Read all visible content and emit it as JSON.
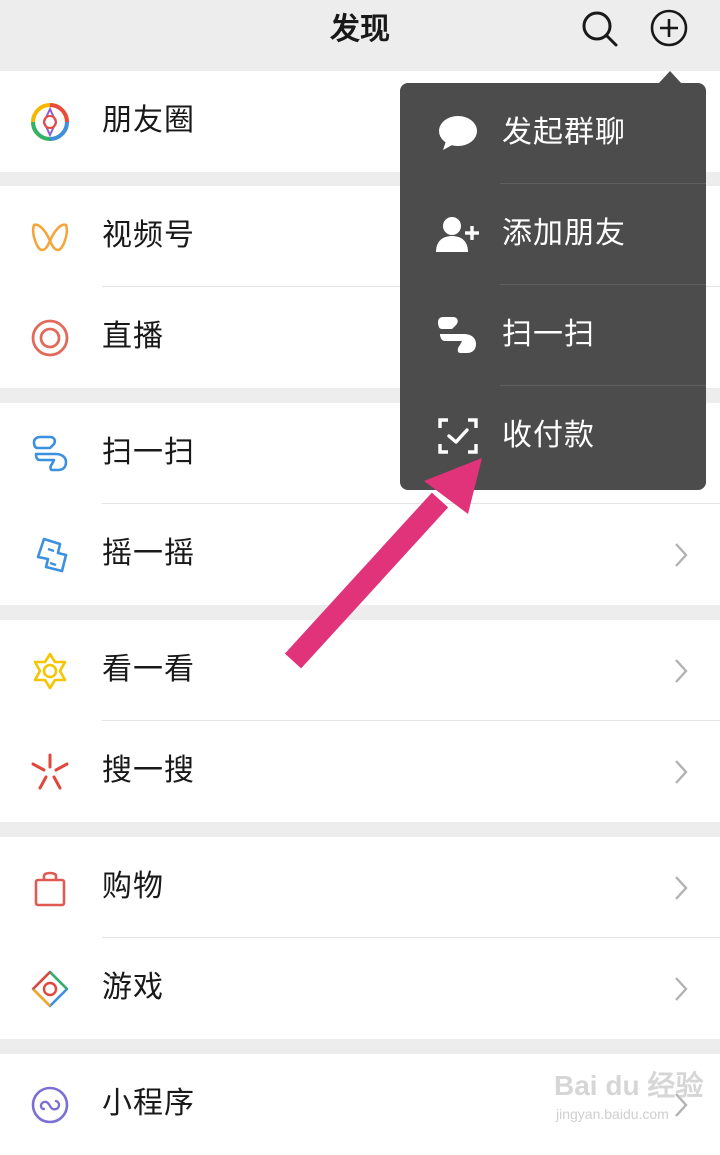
{
  "header": {
    "title": "发现",
    "icons": [
      "search-icon",
      "plus-circle-icon"
    ]
  },
  "groups": [
    {
      "items": [
        {
          "label": "朋友圈",
          "icon": "moments-icon"
        }
      ]
    },
    {
      "items": [
        {
          "label": "视频号",
          "icon": "channels-icon"
        },
        {
          "label": "直播",
          "icon": "live-icon"
        }
      ]
    },
    {
      "items": [
        {
          "label": "扫一扫",
          "icon": "scan-icon"
        },
        {
          "label": "摇一摇",
          "icon": "shake-icon"
        }
      ]
    },
    {
      "items": [
        {
          "label": "看一看",
          "icon": "top-stories-icon"
        },
        {
          "label": "搜一搜",
          "icon": "search-feature-icon"
        }
      ]
    },
    {
      "items": [
        {
          "label": "购物",
          "icon": "shopping-bag-icon"
        },
        {
          "label": "游戏",
          "icon": "games-icon"
        }
      ]
    },
    {
      "items": [
        {
          "label": "小程序",
          "icon": "mini-programs-icon"
        }
      ]
    }
  ],
  "popup_menu": {
    "items": [
      {
        "label": "发起群聊",
        "icon": "chat-bubble-icon"
      },
      {
        "label": "添加朋友",
        "icon": "add-friend-icon"
      },
      {
        "label": "扫一扫",
        "icon": "scan-icon"
      },
      {
        "label": "收付款",
        "icon": "money-icon"
      }
    ]
  },
  "watermark": {
    "brand": "Bai du 经验",
    "site": "jingyan.baidu.com"
  },
  "colors": {
    "background": "#ededed",
    "menu": "#4c4c4c",
    "annotation_arrow": "#e0337a"
  }
}
